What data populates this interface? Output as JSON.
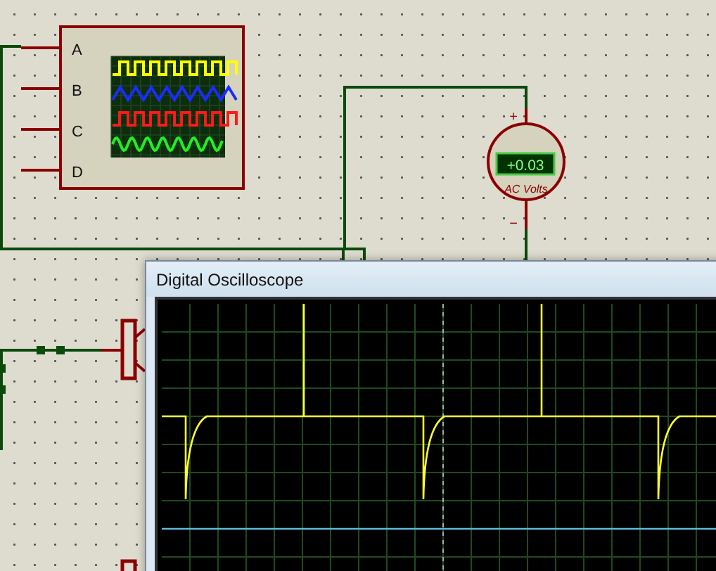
{
  "scope_symbol": {
    "channels": [
      {
        "label": "A",
        "color": "#ffff00",
        "kind": "square"
      },
      {
        "label": "B",
        "color": "#1a2cff",
        "kind": "triangle"
      },
      {
        "label": "C",
        "color": "#ff1a1a",
        "kind": "square"
      },
      {
        "label": "D",
        "color": "#22ee22",
        "kind": "sine"
      }
    ]
  },
  "voltmeter": {
    "plus": "+",
    "reading": "+0.03",
    "label": "AC Volts",
    "minus": "−"
  },
  "window": {
    "title": "Digital Oscilloscope"
  }
}
